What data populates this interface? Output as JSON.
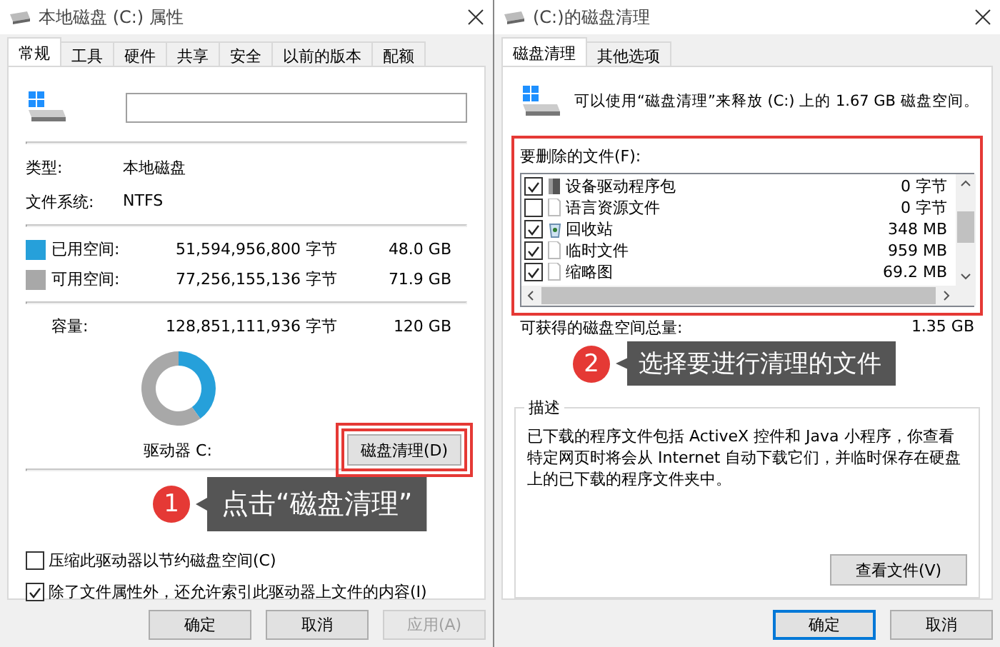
{
  "properties_window": {
    "title": "本地磁盘 (C:) 属性",
    "tabs": [
      {
        "label": "常规",
        "selected": true
      },
      {
        "label": "工具",
        "selected": false
      },
      {
        "label": "硬件",
        "selected": false
      },
      {
        "label": "共享",
        "selected": false
      },
      {
        "label": "安全",
        "selected": false
      },
      {
        "label": "以前的版本",
        "selected": false
      },
      {
        "label": "配额",
        "selected": false
      }
    ],
    "info": [
      {
        "label": "类型:",
        "value": "本地磁盘"
      },
      {
        "label": "文件系统:",
        "value": "NTFS"
      }
    ],
    "space": [
      {
        "label": "已用空间:",
        "bytes": "51,594,956,800 字节",
        "size": "48.0 GB",
        "color": "#26a0da"
      },
      {
        "label": "可用空间:",
        "bytes": "77,256,155,136 字节",
        "size": "71.9 GB",
        "color": "#a8a8a8"
      }
    ],
    "capacity": {
      "label": "容量:",
      "bytes": "128,851,111,936 字节",
      "size": "120 GB"
    },
    "drive_label": "驱动器 C:",
    "cleanup_button": {
      "label": "磁盘清理(D)",
      "highlighted": true
    },
    "options": [
      {
        "label": "压缩此驱动器以节约磁盘空间(C)",
        "checked": false
      },
      {
        "label": "除了文件属性外，还允许索引此驱动器上文件的内容(I)",
        "checked": true
      }
    ],
    "buttons": [
      {
        "label": "确定",
        "disabled": false
      },
      {
        "label": "取消",
        "disabled": false
      },
      {
        "label": "应用(A)",
        "disabled": true
      }
    ]
  },
  "cleanup_window": {
    "title": "(C:)的磁盘清理",
    "tabs": [
      {
        "label": "磁盘清理",
        "selected": true
      },
      {
        "label": "其他选项",
        "selected": false
      }
    ],
    "summary": "可以使用“磁盘清理”来释放 (C:) 上的 1.67 GB 磁盘空间。",
    "files_label": "要删除的文件(F):",
    "files_highlighted": true,
    "files": [
      {
        "name": "设备驱动程序包",
        "size": "0 字节",
        "checked": true,
        "kind": "package"
      },
      {
        "name": "语言资源文件",
        "size": "0 字节",
        "checked": false,
        "kind": "file"
      },
      {
        "name": "回收站",
        "size": "348 MB",
        "checked": true,
        "kind": "recycle"
      },
      {
        "name": "临时文件",
        "size": "959 MB",
        "checked": true,
        "kind": "file"
      },
      {
        "name": "缩略图",
        "size": "69.2 MB",
        "checked": true,
        "kind": "file"
      }
    ],
    "total": {
      "label": "可获得的磁盘空间总量:",
      "value": "1.35 GB"
    },
    "description": {
      "title": "描述",
      "text": "已下载的程序文件包括 ActiveX 控件和 Java 小程序，你查看特定网页时将会从 Internet 自动下载它们，并临时保存在硬盘上的已下载的程序文件夹中。",
      "button": "查看文件(V)"
    },
    "buttons": [
      {
        "label": "确定",
        "default": true
      },
      {
        "label": "取消",
        "default": false
      }
    ]
  },
  "callouts": [
    {
      "number": "1",
      "text": "点击“磁盘清理”"
    },
    {
      "number": "2",
      "text": "选择要进行清理的文件"
    }
  ]
}
